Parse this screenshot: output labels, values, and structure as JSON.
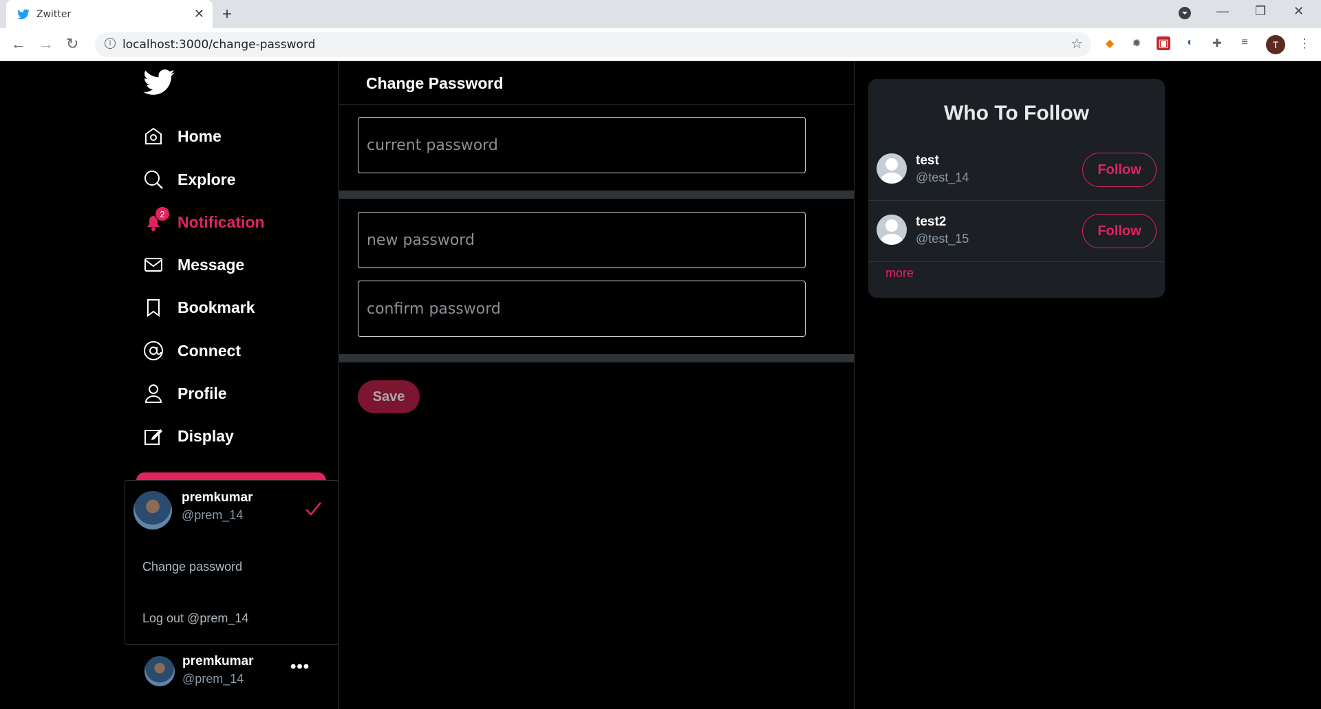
{
  "browser": {
    "tab_title": "Zwitter",
    "url": "localhost:3000/change-password",
    "profile_initial": "T"
  },
  "sidebar": {
    "items": [
      {
        "label": "Home",
        "icon": "home-icon"
      },
      {
        "label": "Explore",
        "icon": "search-icon"
      },
      {
        "label": "Notification",
        "icon": "bell-icon",
        "badge": "2",
        "active": true
      },
      {
        "label": "Message",
        "icon": "mail-icon"
      },
      {
        "label": "Bookmark",
        "icon": "bookmark-icon"
      },
      {
        "label": "Connect",
        "icon": "at-icon"
      },
      {
        "label": "Profile",
        "icon": "user-icon"
      },
      {
        "label": "Display",
        "icon": "edit-icon"
      }
    ]
  },
  "account_popup": {
    "name": "premkumar",
    "handle": "@prem_14",
    "change_password": "Change password",
    "logout": "Log out @prem_14"
  },
  "current_user": {
    "name": "premkumar",
    "handle": "@prem_14"
  },
  "main": {
    "title": "Change Password",
    "current_placeholder": "current password",
    "new_placeholder": "new password",
    "confirm_placeholder": "confirm password",
    "save_label": "Save"
  },
  "who_to_follow": {
    "title": "Who To Follow",
    "users": [
      {
        "name": "test",
        "handle": "@test_14",
        "button": "Follow"
      },
      {
        "name": "test2",
        "handle": "@test_15",
        "button": "Follow"
      }
    ],
    "more": "more"
  },
  "colors": {
    "accent": "#e0245e",
    "background": "#000000",
    "card": "#1c1f23"
  }
}
